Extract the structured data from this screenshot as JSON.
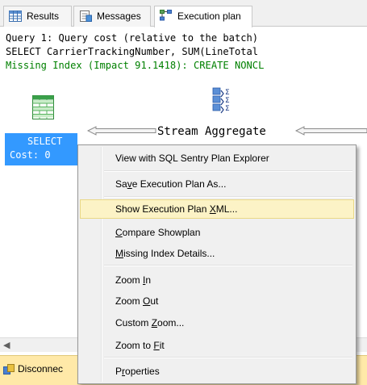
{
  "tabs": [
    {
      "label": "Results",
      "icon": "grid-icon",
      "active": false
    },
    {
      "label": "Messages",
      "icon": "messages-icon",
      "active": false
    },
    {
      "label": "Execution plan",
      "icon": "execution-plan-icon",
      "active": true
    }
  ],
  "query": {
    "line1": "Query 1: Query cost (relative to the batch)",
    "line2": "SELECT CarrierTrackingNumber, SUM(LineTotal",
    "line3": "Missing Index (Impact 91.1418): CREATE NONCL"
  },
  "plan": {
    "select_label": "SELECT",
    "select_cost": "Cost: 0",
    "aggregate_label": "Stream Aggregate",
    "select_icon": "table-select-icon",
    "aggregate_icon": "stream-aggregate-icon"
  },
  "status": {
    "text": "Disconnec",
    "icon": "disconnected-icon"
  },
  "menu": {
    "items": [
      {
        "pre": "View with SQL Sentry Plan Explorer",
        "key": "",
        "post": ""
      },
      {
        "pre": "Sa",
        "key": "v",
        "post": "e Execution Plan As..."
      },
      {
        "pre": "Show Execution Plan ",
        "key": "X",
        "post": "ML..."
      },
      {
        "pre": "",
        "key": "C",
        "post": "ompare Showplan"
      },
      {
        "pre": "",
        "key": "M",
        "post": "issing Index Details..."
      },
      {
        "pre": "Zoom ",
        "key": "I",
        "post": "n"
      },
      {
        "pre": "Zoom ",
        "key": "O",
        "post": "ut"
      },
      {
        "pre": "Custom ",
        "key": "Z",
        "post": "oom..."
      },
      {
        "pre": "Zoom to ",
        "key": "F",
        "post": "it"
      },
      {
        "pre": "P",
        "key": "r",
        "post": "operties"
      }
    ]
  },
  "colors": {
    "selection_blue": "#3399ff",
    "missing_index_green": "#008000",
    "menu_highlight": "#fcf3c6",
    "status_bar": "#ffe9a8"
  }
}
